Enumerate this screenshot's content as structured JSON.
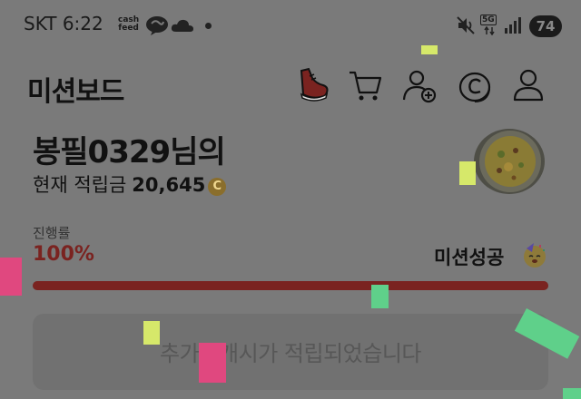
{
  "status_bar": {
    "carrier_time": "SKT 6:22",
    "cashfeed_line1": "cash",
    "cashfeed_line2": "feed",
    "network": "5G",
    "battery": "74"
  },
  "header": {
    "title": "미션보드",
    "icons": [
      "shoe-icon",
      "cart-icon",
      "add-user-icon",
      "coin-c-icon",
      "profile-icon"
    ]
  },
  "profile": {
    "greeting": "봉필0329님의",
    "points_label": "현재 적립금",
    "points_value": "20,645",
    "coin_symbol": "C"
  },
  "progress": {
    "label": "진행률",
    "value": "100%",
    "percent": 100,
    "status": "미션성공"
  },
  "notice": {
    "text": "추가 4개시가 적립되었습니다"
  },
  "colors": {
    "accent": "#7a2320",
    "overlay_bg": "#7a7a7a",
    "confetti": [
      "#d6e86a",
      "#e0487f",
      "#5fd08a"
    ]
  }
}
